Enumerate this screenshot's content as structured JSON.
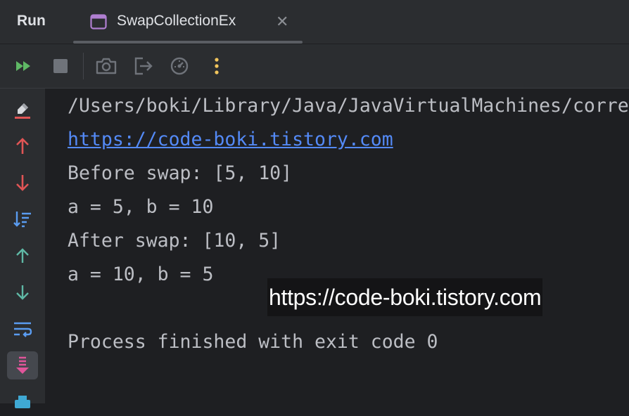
{
  "header": {
    "run_label": "Run",
    "tab": {
      "label": "SwapCollectionEx",
      "close_symbol": "✕"
    }
  },
  "toolbar": {
    "buttons": [
      {
        "icon": "rerun-icon",
        "color": "#5fb865"
      },
      {
        "icon": "stop-icon",
        "color": "#6f737a"
      },
      {
        "icon": "camera-icon",
        "color": "#6f737a"
      },
      {
        "icon": "exit-icon",
        "color": "#6f737a"
      },
      {
        "icon": "profiler-icon",
        "color": "#6f737a"
      },
      {
        "icon": "more-icon",
        "color": "#f2c55c"
      }
    ]
  },
  "sidebar": {
    "buttons": [
      "clear-icon",
      "arrow-up-icon",
      "arrow-down-icon",
      "sort-icon",
      "up-icon",
      "down-icon",
      "soft-wrap-icon",
      "scroll-to-end-icon",
      "print-icon"
    ]
  },
  "console": {
    "lines": [
      "/Users/boki/Library/Java/JavaVirtualMachines/corretto",
      "https://code-boki.tistory.com",
      "Before swap: [5, 10]",
      "a = 5, b = 10",
      "After swap: [10, 5]",
      "a = 10, b = 5",
      "",
      "Process finished with exit code 0"
    ]
  },
  "watermark": {
    "text": "https://code-boki.tistory.com"
  },
  "colors": {
    "link": "#548af7",
    "text": "#bcbec4",
    "background": "#1e1f22",
    "panel": "#2b2d30"
  }
}
